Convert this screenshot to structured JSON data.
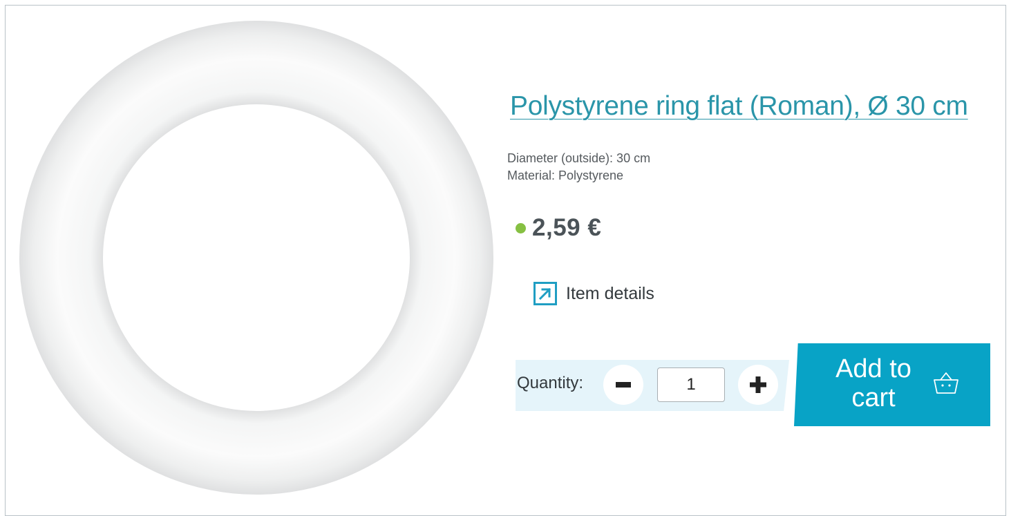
{
  "product": {
    "title": "Polystyrene ring flat (Roman), Ø 30 cm",
    "attributes": [
      "Diameter (outside): 30 cm",
      "Material: Polystyrene"
    ],
    "price": "2,59 €",
    "stock_status_color": "#86c042",
    "image_icon": "polystyrene-ring-image"
  },
  "links": {
    "item_details_label": "Item details",
    "item_details_icon": "external-link-icon"
  },
  "quantity": {
    "label": "Quantity:",
    "value": "1",
    "decrement_icon": "minus-icon",
    "increment_icon": "plus-icon"
  },
  "cart": {
    "add_label_line1": "Add to",
    "add_label_line2": "cart",
    "icon": "basket-icon"
  },
  "colors": {
    "accent": "#08a3c6",
    "title_link": "#2a95a9",
    "quantity_bar": "#e5f4fa"
  }
}
